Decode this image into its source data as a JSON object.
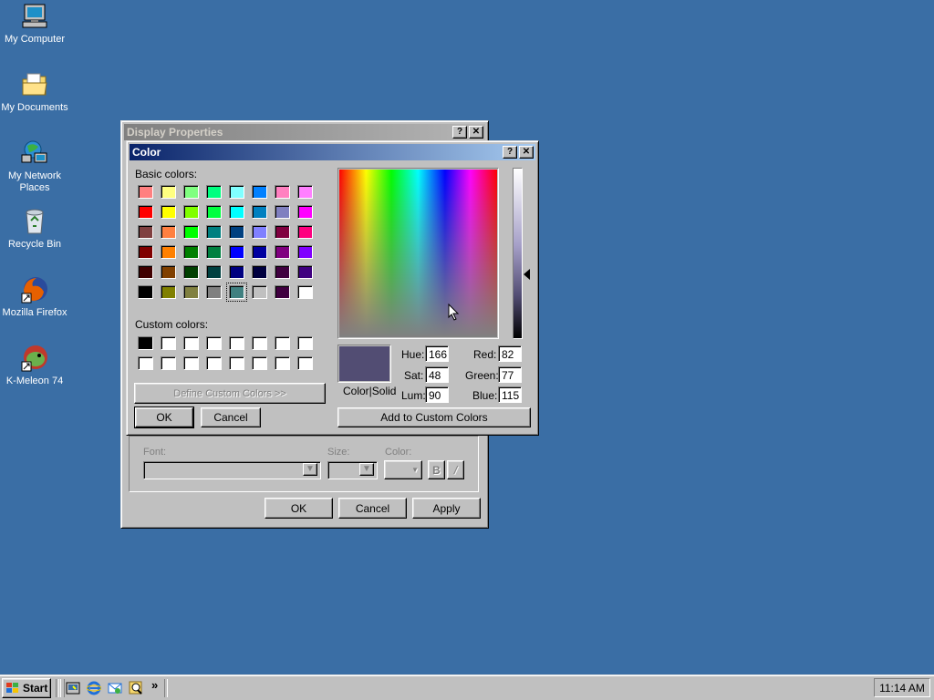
{
  "desktop": {
    "icons": [
      {
        "label": "My Computer",
        "icon": "computer-icon"
      },
      {
        "label": "My Documents",
        "icon": "folder-icon"
      },
      {
        "label": "My Network Places",
        "icon": "network-icon"
      },
      {
        "label": "Recycle Bin",
        "icon": "recycle-bin-icon"
      },
      {
        "label": "Mozilla Firefox",
        "icon": "firefox-icon"
      },
      {
        "label": "K-Meleon 74",
        "icon": "kmeleon-icon"
      }
    ],
    "background_color": "#3a6ea5"
  },
  "display_properties": {
    "title": "Display Properties",
    "font_label": "Font:",
    "size_label": "Size:",
    "color_label": "Color:",
    "bold_label": "B",
    "italic_label": "/",
    "ok_label": "OK",
    "cancel_label": "Cancel",
    "apply_label": "Apply"
  },
  "color_dialog": {
    "title": "Color",
    "help_label": "?",
    "close_label": "✕",
    "basic_colors_label": "Basic colors:",
    "custom_colors_label": "Custom colors:",
    "define_custom_label": "Define Custom Colors >>",
    "ok_label": "OK",
    "cancel_label": "Cancel",
    "add_custom_label": "Add to Custom Colors",
    "color_solid_label": "Color|Solid",
    "hue_label": "Hue:",
    "sat_label": "Sat:",
    "lum_label": "Lum:",
    "red_label": "Red:",
    "green_label": "Green:",
    "blue_label": "Blue:",
    "hue": "166",
    "sat": "48",
    "lum": "90",
    "red": "82",
    "green": "77",
    "blue": "115",
    "preview_color": "#524d73",
    "basic_colors": [
      [
        "#ff8080",
        "#ffff80",
        "#80ff80",
        "#00ff80",
        "#80ffff",
        "#0080ff",
        "#ff80c0",
        "#ff80ff"
      ],
      [
        "#ff0000",
        "#ffff00",
        "#80ff00",
        "#00ff40",
        "#00ffff",
        "#0080c0",
        "#8080c0",
        "#ff00ff"
      ],
      [
        "#804040",
        "#ff8040",
        "#00ff00",
        "#008080",
        "#004080",
        "#8080ff",
        "#800040",
        "#ff0080"
      ],
      [
        "#800000",
        "#ff8000",
        "#008000",
        "#008040",
        "#0000ff",
        "#0000a0",
        "#800080",
        "#8000ff"
      ],
      [
        "#400000",
        "#804000",
        "#004000",
        "#004040",
        "#000080",
        "#000040",
        "#400040",
        "#400080"
      ],
      [
        "#000000",
        "#808000",
        "#808040",
        "#808080",
        "#408080",
        "#c0c0c0",
        "#400040",
        "#ffffff"
      ]
    ],
    "selected_basic": [
      5,
      4
    ],
    "custom_colors": [
      [
        "#000000",
        "#ffffff",
        "#ffffff",
        "#ffffff",
        "#ffffff",
        "#ffffff",
        "#ffffff",
        "#ffffff"
      ],
      [
        "#ffffff",
        "#ffffff",
        "#ffffff",
        "#ffffff",
        "#ffffff",
        "#ffffff",
        "#ffffff",
        "#ffffff"
      ]
    ]
  },
  "taskbar": {
    "start_label": "Start",
    "quick_launch": [
      "desktop-icon",
      "internet-explorer-icon",
      "outlook-icon",
      "search-icon"
    ],
    "more_label": "»",
    "clock": "11:14 AM"
  }
}
